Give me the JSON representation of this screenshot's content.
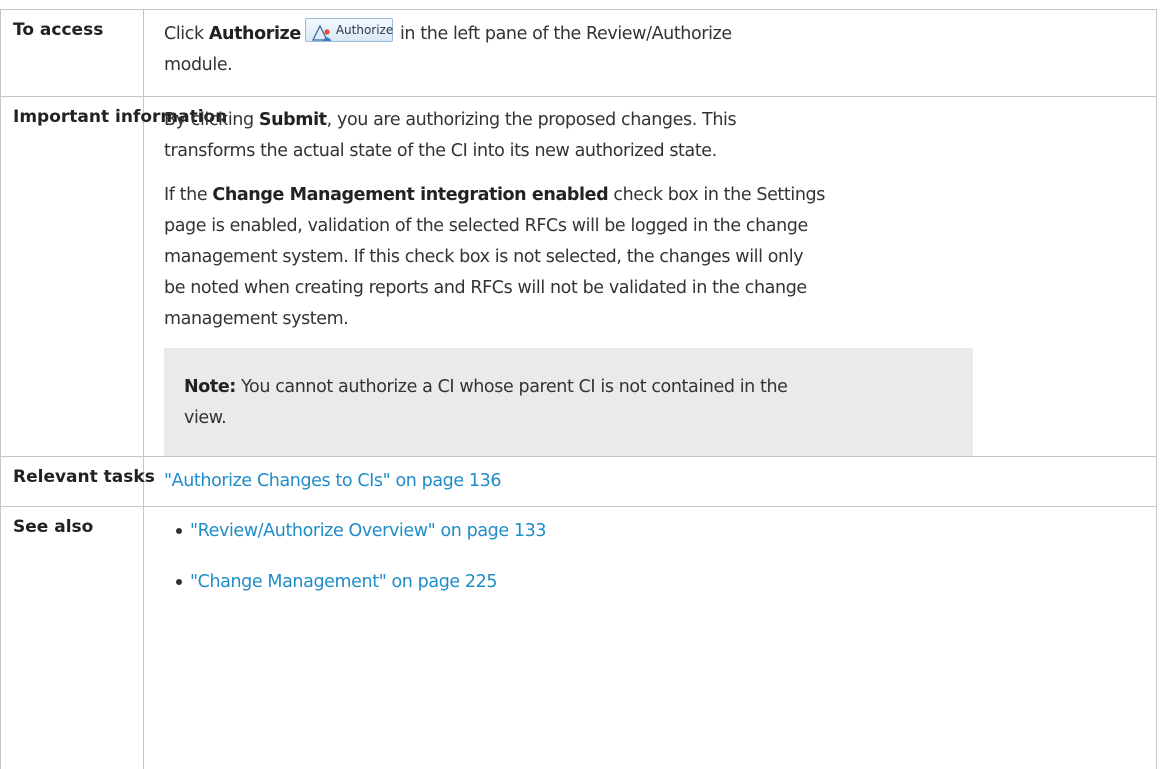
{
  "rows": {
    "access": {
      "label": "To access",
      "text_before": "Click ",
      "bold": "Authorize",
      "button_label": "Authorize",
      "text_after": " in the left pane of the Review/Authorize",
      "text_line2": "module."
    },
    "important": {
      "label": "Important information",
      "p1_before": "By clicking ",
      "p1_bold": "Submit",
      "p1_line1_after": ", you are authorizing the proposed changes. This",
      "p1_line2": "transforms the actual state of the CI into its new authorized state.",
      "p2_before": "If the ",
      "p2_bold": "Change Management integration enabled",
      "p2_line1_after": " check box in the Settings",
      "p2_line2": "page is enabled, validation of the selected RFCs will be logged in the change",
      "p2_line3": "management system. If this check box is not selected, the changes will only",
      "p2_line4": "be noted when creating reports and RFCs will not be validated in the change",
      "p2_line5": "management system.",
      "note_label": "Note:",
      "note_line1": " You cannot authorize a CI whose parent CI is not contained in the",
      "note_line2": "view."
    },
    "tasks": {
      "label": "Relevant tasks",
      "link": "\"Authorize Changes to CIs\" on page 136"
    },
    "see_also": {
      "label": "See also",
      "links": [
        "\"Review/Authorize Overview\" on page 133",
        "\"Change Management\" on page 225"
      ]
    }
  },
  "colors": {
    "link": "#1f8cc8",
    "border": "#c6c6c6",
    "note_bg": "#e9ebeb"
  },
  "icons": {
    "authorize": "authorize-icon"
  }
}
